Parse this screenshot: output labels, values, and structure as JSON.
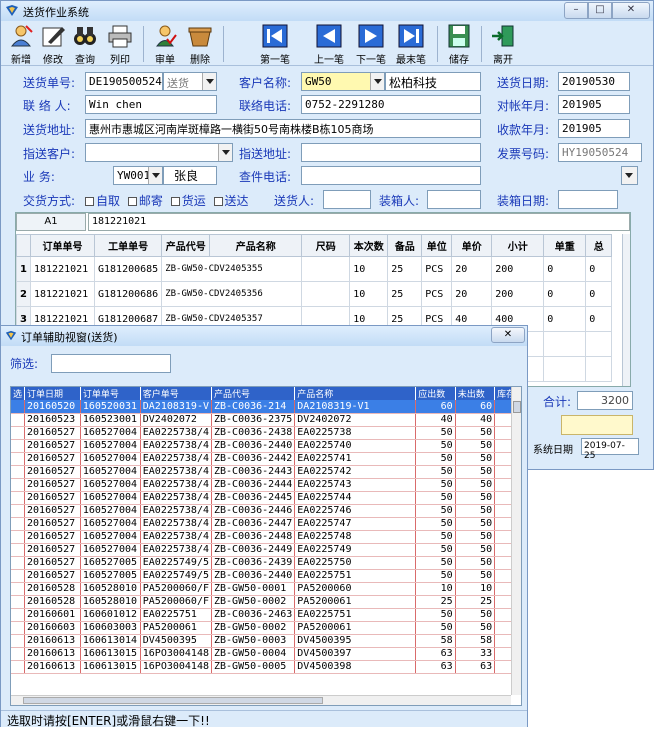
{
  "app": {
    "title": "送货作业系统"
  },
  "window_buttons": {
    "min": "–",
    "max": "□",
    "close": "✕"
  },
  "toolbar": [
    {
      "label": "新增",
      "icon": "new-user-icon"
    },
    {
      "label": "修改",
      "icon": "edit-icon"
    },
    {
      "label": "查询",
      "icon": "binoculars-icon"
    },
    {
      "label": "列印",
      "icon": "print-icon"
    },
    {
      "label": "审单",
      "icon": "approve-icon"
    },
    {
      "label": "删除",
      "icon": "delete-icon"
    },
    {
      "label": "第一笔",
      "icon": "first-record-icon"
    },
    {
      "label": "上一笔",
      "icon": "prev-record-icon"
    },
    {
      "label": "下一笔",
      "icon": "next-record-icon"
    },
    {
      "label": "最末笔",
      "icon": "last-record-icon"
    },
    {
      "label": "储存",
      "icon": "save-icon"
    },
    {
      "label": "离开",
      "icon": "exit-icon"
    }
  ],
  "form": {
    "delivery_no_label": "送货单号:",
    "delivery_no": "DE190500524",
    "delivery_type": "送货",
    "customer_label": "客户名称:",
    "customer_code": "GW50",
    "customer_name": "松柏科技",
    "delivery_date_label": "送货日期:",
    "delivery_date": "20190530",
    "contact_label": "联 络 人:",
    "contact": "Win chen",
    "phone_label": "联络电话:",
    "phone": "0752-2291280",
    "statement_month_label": "对帐年月:",
    "statement_month": "201905",
    "address_label": "送货地址:",
    "address": "惠州市惠城区河南岸斑樟路一横街50号南株楼B栋105商场",
    "collection_month_label": "收款年月:",
    "collection_month": "201905",
    "assign_customer_label": "指送客户:",
    "assign_customer": "",
    "assign_address_label": "指送地址:",
    "assign_address": "",
    "invoice_label": "发票号码:",
    "invoice": "HY19050524",
    "sales_label": "业    务:",
    "sales_code": "YW0017",
    "sales_name": "张良",
    "check_phone_label": "查件电话:",
    "check_phone": "",
    "delivery_method_label": "交货方式:",
    "delivery_methods": [
      "自取",
      "邮寄",
      "货运",
      "送达"
    ],
    "deliverer_label": "送货人:",
    "deliverer": "",
    "packer_label": "装箱人:",
    "packer": "",
    "pack_date_label": "装箱日期:",
    "pack_date": ""
  },
  "grid": {
    "cell_ref": "A1",
    "cell_value": "181221021",
    "columns": [
      "订单单号",
      "工单单号",
      "产品代号",
      "产品名称",
      "尺码",
      "本次数",
      "备品",
      "单位",
      "单价",
      "小计",
      "单重",
      "总"
    ],
    "rows": [
      {
        "n": "1",
        "cells": [
          "181221021",
          "G181200685",
          "ZB-GW50-CDV2405355",
          "",
          "",
          "10",
          "25",
          "PCS",
          "20",
          "200",
          "0",
          "0"
        ]
      },
      {
        "n": "2",
        "cells": [
          "181221021",
          "G181200686",
          "ZB-GW50-CDV2405356",
          "",
          "",
          "10",
          "25",
          "PCS",
          "20",
          "200",
          "0",
          "0"
        ]
      },
      {
        "n": "3",
        "cells": [
          "181221021",
          "G181200687",
          "ZB-GW50-CDV2405357",
          "",
          "",
          "10",
          "25",
          "PCS",
          "40",
          "400",
          "0",
          "0"
        ]
      }
    ]
  },
  "summary": {
    "total_label": "合计:",
    "total": "3200",
    "sys_date_label": "系统日期",
    "sys_date": "2019-07-25"
  },
  "popup": {
    "title": "订单辅助视窗(送货)",
    "close": "✕",
    "filter_label": "筛选:",
    "columns": [
      "选",
      "订单日期",
      "订单单号",
      "客户单号",
      "产品代号",
      "产品名称",
      "应出数",
      "未出数",
      "库存"
    ],
    "rows": [
      [
        "20160520",
        "160520031",
        "DA2108319-V",
        "ZB-C0036-214",
        "DA2108319-V1",
        "60",
        "60"
      ],
      [
        "20160523",
        "160523001",
        "DV2402072",
        "ZB-C0036-2375",
        "DV2402072",
        "40",
        "40"
      ],
      [
        "20160527",
        "160527004",
        "EA0225738/4",
        "ZB-C0036-2438",
        "EA0225738",
        "50",
        "50"
      ],
      [
        "20160527",
        "160527004",
        "EA0225738/4",
        "ZB-C0036-2440",
        "EA0225740",
        "50",
        "50"
      ],
      [
        "20160527",
        "160527004",
        "EA0225738/4",
        "ZB-C0036-2442",
        "EA0225741",
        "50",
        "50"
      ],
      [
        "20160527",
        "160527004",
        "EA0225738/4",
        "ZB-C0036-2443",
        "EA0225742",
        "50",
        "50"
      ],
      [
        "20160527",
        "160527004",
        "EA0225738/4",
        "ZB-C0036-2444",
        "EA0225743",
        "50",
        "50"
      ],
      [
        "20160527",
        "160527004",
        "EA0225738/4",
        "ZB-C0036-2445",
        "EA0225744",
        "50",
        "50"
      ],
      [
        "20160527",
        "160527004",
        "EA0225738/4",
        "ZB-C0036-2446",
        "EA0225746",
        "50",
        "50"
      ],
      [
        "20160527",
        "160527004",
        "EA0225738/4",
        "ZB-C0036-2447",
        "EA0225747",
        "50",
        "50"
      ],
      [
        "20160527",
        "160527004",
        "EA0225738/4",
        "ZB-C0036-2448",
        "EA0225748",
        "50",
        "50"
      ],
      [
        "20160527",
        "160527004",
        "EA0225738/4",
        "ZB-C0036-2449",
        "EA0225749",
        "50",
        "50"
      ],
      [
        "20160527",
        "160527005",
        "EA0225749/5",
        "ZB-C0036-2439",
        "EA0225750",
        "50",
        "50"
      ],
      [
        "20160527",
        "160527005",
        "EA0225749/5",
        "ZB-C0036-2440",
        "EA0225751",
        "50",
        "50"
      ],
      [
        "20160528",
        "160528010",
        "PA5200060/F",
        "ZB-GW50-0001",
        "PA5200060",
        "10",
        "10"
      ],
      [
        "20160528",
        "160528010",
        "PA5200060/F",
        "ZB-GW50-0002",
        "PA5200061",
        "25",
        "25"
      ],
      [
        "20160601",
        "160601012",
        "EA0225751",
        "ZB-C0036-2463",
        "EA0225751",
        "50",
        "50"
      ],
      [
        "20160603",
        "160603003",
        "PA5200061",
        "ZB-GW50-0002",
        "PA5200061",
        "50",
        "50"
      ],
      [
        "20160613",
        "160613014",
        "DV4500395",
        "ZB-GW50-0003",
        "DV4500395",
        "58",
        "58"
      ],
      [
        "20160613",
        "160613015",
        "16PO3004148",
        "ZB-GW50-0004",
        "DV4500397",
        "63",
        "33"
      ],
      [
        "20160613",
        "160613015",
        "16PO3004148",
        "ZB-GW50-0005",
        "DV4500398",
        "63",
        "63"
      ]
    ],
    "status": "选取时请按[ENTER]或滑鼠右键一下!!"
  }
}
